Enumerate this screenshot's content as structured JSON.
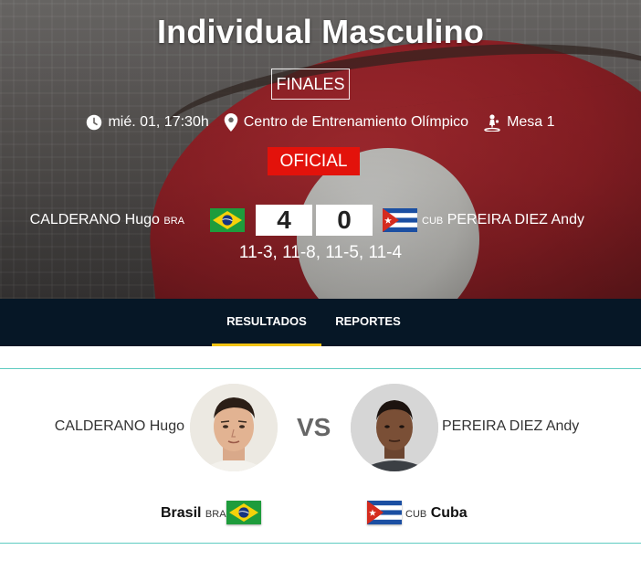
{
  "event": {
    "title": "Individual Masculino",
    "phase": "FINALES",
    "date_time": "mié. 01, 17:30h",
    "venue": "Centro de Entrenamiento Olímpico",
    "table": "Mesa 1",
    "status": "OFICIAL",
    "colors": {
      "status_bg": "#e3120b",
      "tab_bar_bg": "#061726",
      "tab_active_underline": "#f2c313",
      "divider": "#5fcbc1"
    }
  },
  "match": {
    "left": {
      "name": "CALDERANO Hugo",
      "code": "BRA",
      "country": "Brasil",
      "flag": "brazil-flag",
      "score": "4"
    },
    "right": {
      "name": "PEREIRA DIEZ Andy",
      "code": "CUB",
      "country": "Cuba",
      "flag": "cuba-flag",
      "score": "0"
    },
    "sets": "11-3, 11-8, 11-5, 11-4",
    "vs": "VS"
  },
  "tabs": [
    {
      "label": "RESULTADOS",
      "active": true
    },
    {
      "label": "REPORTES",
      "active": false
    }
  ],
  "icons": {
    "time": "clock-icon",
    "venue": "location-pin-icon",
    "table": "table-tennis-player-icon"
  }
}
